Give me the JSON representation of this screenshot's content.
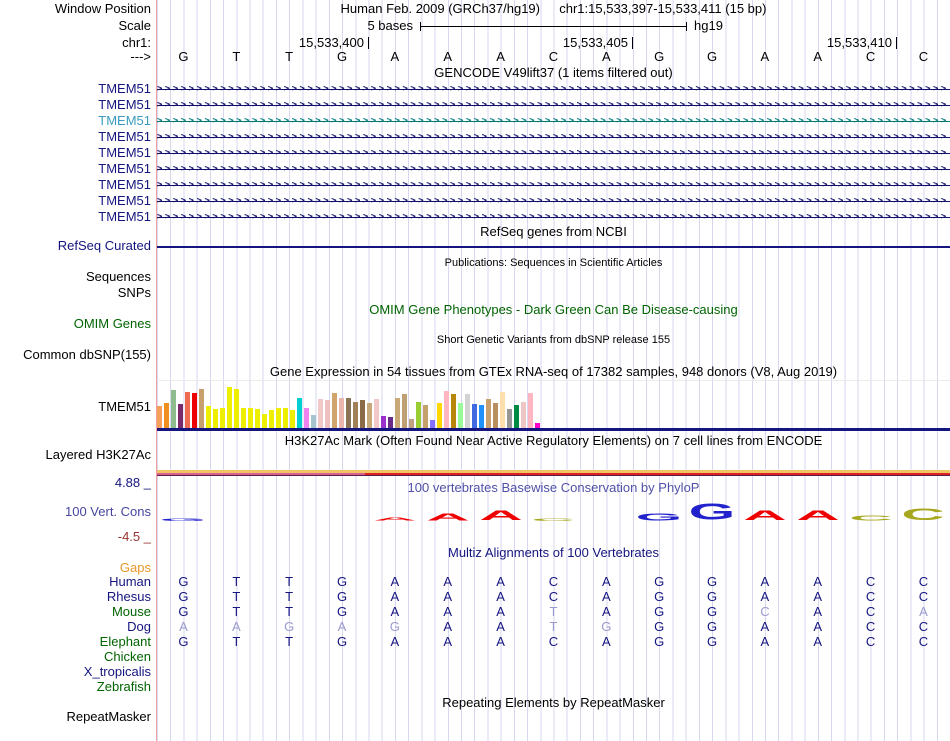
{
  "header": {
    "window_position_label": "Window Position",
    "title_assembly": "Human Feb. 2009 (GRCh37/hg19)",
    "title_range": "chr1:15,533,397-15,533,411 (15 bp)",
    "scale_label": "Scale",
    "scale_bases": "5 bases",
    "scale_assembly": "hg19",
    "chrom_label": "chr1:",
    "strand_arrow": "--->",
    "coordinates": [
      "15,533,400",
      "15,533,405",
      "15,533,410"
    ]
  },
  "sequence": {
    "bases": [
      "G",
      "T",
      "T",
      "G",
      "A",
      "A",
      "A",
      "C",
      "A",
      "G",
      "G",
      "A",
      "A",
      "C",
      "C"
    ]
  },
  "tracks": {
    "gencode": {
      "title": "GENCODE V49lift37 (1 items filtered out)",
      "genes": [
        {
          "label": "TMEM51",
          "label_color": "#151580",
          "arrow_color": "#10106a"
        },
        {
          "label": "TMEM51",
          "label_color": "#151580",
          "arrow_color": "#10106a"
        },
        {
          "label": "TMEM51",
          "label_color": "#3a9bbf",
          "arrow_color": "#007878"
        },
        {
          "label": "TMEM51",
          "label_color": "#151580",
          "arrow_color": "#10106a"
        },
        {
          "label": "TMEM51",
          "label_color": "#151580",
          "arrow_color": "#10106a"
        },
        {
          "label": "TMEM51",
          "label_color": "#151580",
          "arrow_color": "#10106a"
        },
        {
          "label": "TMEM51",
          "label_color": "#151580",
          "arrow_color": "#10106a"
        },
        {
          "label": "TMEM51",
          "label_color": "#151580",
          "arrow_color": "#10106a"
        },
        {
          "label": "TMEM51",
          "label_color": "#151580",
          "arrow_color": "#10106a"
        }
      ]
    },
    "refseq": {
      "title": "RefSeq genes from NCBI",
      "label": "RefSeq Curated"
    },
    "publications": {
      "title": "Publications: Sequences in Scientific Articles",
      "label_sequences": "Sequences",
      "label_snps": "SNPs"
    },
    "omim": {
      "title": "OMIM Gene Phenotypes - Dark Green Can Be Disease-causing",
      "label": "OMIM Genes"
    },
    "dbsnp": {
      "title": "Short Genetic Variants from dbSNP release 155",
      "label": "Common dbSNP(155)"
    },
    "gtex": {
      "title": "Gene Expression in 54 tissues from GTEx RNA-seq of 17382 samples, 948 donors (V8, Aug 2019)",
      "label": "TMEM51",
      "bars": [
        {
          "color": "#f4a05a",
          "h": 0.45
        },
        {
          "color": "#ef8f1f",
          "h": 0.52
        },
        {
          "color": "#8fbc8f",
          "h": 0.8
        },
        {
          "color": "#7a2a6a",
          "h": 0.5
        },
        {
          "color": "#ee6a50",
          "h": 0.75
        },
        {
          "color": "#ee0000",
          "h": 0.72
        },
        {
          "color": "#c8a06e",
          "h": 0.82
        },
        {
          "color": "#eeee00",
          "h": 0.45
        },
        {
          "color": "#eeee00",
          "h": 0.4
        },
        {
          "color": "#eeee00",
          "h": 0.42
        },
        {
          "color": "#eeee00",
          "h": 0.85
        },
        {
          "color": "#eeee00",
          "h": 0.82
        },
        {
          "color": "#eeee00",
          "h": 0.42
        },
        {
          "color": "#eeee00",
          "h": 0.42
        },
        {
          "color": "#eeee00",
          "h": 0.4
        },
        {
          "color": "#eeee00",
          "h": 0.3
        },
        {
          "color": "#eeee00",
          "h": 0.38
        },
        {
          "color": "#eeee00",
          "h": 0.42
        },
        {
          "color": "#eeee00",
          "h": 0.42
        },
        {
          "color": "#eeee00",
          "h": 0.38
        },
        {
          "color": "#00ced1",
          "h": 0.62
        },
        {
          "color": "#ee82ee",
          "h": 0.42
        },
        {
          "color": "#a6c4d0",
          "h": 0.28
        },
        {
          "color": "#f0c8c8",
          "h": 0.6
        },
        {
          "color": "#eec0c0",
          "h": 0.58
        },
        {
          "color": "#d2a56e",
          "h": 0.72
        },
        {
          "color": "#eab6ae",
          "h": 0.62
        },
        {
          "color": "#8b7355",
          "h": 0.62
        },
        {
          "color": "#a08058",
          "h": 0.55
        },
        {
          "color": "#8b6b47",
          "h": 0.58
        },
        {
          "color": "#c8a878",
          "h": 0.52
        },
        {
          "color": "#f2c8c8",
          "h": 0.6
        },
        {
          "color": "#9932cc",
          "h": 0.26
        },
        {
          "color": "#6a2a8a",
          "h": 0.22
        },
        {
          "color": "#c9a877",
          "h": 0.62
        },
        {
          "color": "#bfa075",
          "h": 0.7
        },
        {
          "color": "#c0a080",
          "h": 0.18
        },
        {
          "color": "#9acd32",
          "h": 0.55
        },
        {
          "color": "#c4a06a",
          "h": 0.48
        },
        {
          "color": "#8470ff",
          "h": 0.16
        },
        {
          "color": "#ffd700",
          "h": 0.52
        },
        {
          "color": "#ffb6c1",
          "h": 0.78
        },
        {
          "color": "#b8860b",
          "h": 0.7
        },
        {
          "color": "#98fb98",
          "h": 0.52
        },
        {
          "color": "#d3d3d3",
          "h": 0.7
        },
        {
          "color": "#4169e1",
          "h": 0.5
        },
        {
          "color": "#1e90ff",
          "h": 0.48
        },
        {
          "color": "#c8a06e",
          "h": 0.6
        },
        {
          "color": "#b89060",
          "h": 0.52
        },
        {
          "color": "#ffdead",
          "h": 0.75
        },
        {
          "color": "#969696",
          "h": 0.4
        },
        {
          "color": "#008b45",
          "h": 0.48
        },
        {
          "color": "#eec6c6",
          "h": 0.55
        },
        {
          "color": "#ffb6c1",
          "h": 0.72
        },
        {
          "color": "#ff00cc",
          "h": 0.1
        }
      ]
    },
    "h3k27ac": {
      "title": "H3K27Ac Mark (Often Found Near Active Regulatory Elements) on 7 cell lines from ENCODE",
      "label": "Layered H3K27Ac",
      "band_colors": {
        "top": "#f0c464",
        "pink": "#d8608e",
        "red": "#dd2222",
        "bottom": "#5a1a4a"
      }
    },
    "conservation": {
      "title": "100 vertebrates Basewise Conservation by PhyloP",
      "label": "100 Vert. Cons",
      "max_label": "4.88 _",
      "min_label": "-4.5 _",
      "letters": [
        {
          "letter": "G",
          "color": "#2222cc",
          "h": 0.15
        },
        null,
        null,
        null,
        {
          "letter": "A",
          "color": "#ee0000",
          "h": 0.18
        },
        {
          "letter": "A",
          "color": "#ee0000",
          "h": 0.42
        },
        {
          "letter": "A",
          "color": "#ee0000",
          "h": 0.6
        },
        {
          "letter": "C",
          "color": "#a8a820",
          "h": 0.15
        },
        null,
        {
          "letter": "G",
          "color": "#2222cc",
          "h": 0.45
        },
        {
          "letter": "G",
          "color": "#2222cc",
          "h": 1.0
        },
        {
          "letter": "A",
          "color": "#ee0000",
          "h": 0.6
        },
        {
          "letter": "A",
          "color": "#ee0000",
          "h": 0.6
        },
        {
          "letter": "C",
          "color": "#a8a820",
          "h": 0.32
        },
        {
          "letter": "C",
          "color": "#a8a820",
          "h": 0.72
        }
      ]
    },
    "multiz": {
      "title": "Multiz Alignments of 100 Vertebrates",
      "gaps_label": "Gaps",
      "species": [
        {
          "name": "Human",
          "color": "#151580",
          "bases": [
            "G",
            "T",
            "T",
            "G",
            "A",
            "A",
            "A",
            "C",
            "A",
            "G",
            "G",
            "A",
            "A",
            "C",
            "C"
          ],
          "faded": []
        },
        {
          "name": "Rhesus",
          "color": "#151580",
          "bases": [
            "G",
            "T",
            "T",
            "G",
            "A",
            "A",
            "A",
            "C",
            "A",
            "G",
            "G",
            "A",
            "A",
            "C",
            "C"
          ],
          "faded": []
        },
        {
          "name": "Mouse",
          "color": "#006400",
          "bases": [
            "G",
            "T",
            "T",
            "G",
            "A",
            "A",
            "A",
            "T",
            "A",
            "G",
            "G",
            "C",
            "A",
            "C",
            "A"
          ],
          "faded": [
            7,
            11,
            14
          ]
        },
        {
          "name": "Dog",
          "color": "#151580",
          "bases": [
            "A",
            "A",
            "G",
            "A",
            "G",
            "A",
            "A",
            "T",
            "G",
            "G",
            "G",
            "A",
            "A",
            "C",
            "C"
          ],
          "faded": [
            0,
            1,
            2,
            3,
            4,
            7,
            8
          ]
        },
        {
          "name": "Elephant",
          "color": "#006400",
          "bases": [
            "G",
            "T",
            "T",
            "G",
            "A",
            "A",
            "A",
            "C",
            "A",
            "G",
            "G",
            "A",
            "A",
            "C",
            "C"
          ],
          "faded": []
        },
        {
          "name": "Chicken",
          "color": "#006400",
          "bases": [],
          "faded": []
        },
        {
          "name": "X_tropicalis",
          "color": "#151580",
          "bases": [],
          "faded": []
        },
        {
          "name": "Zebrafish",
          "color": "#006400",
          "bases": [],
          "faded": []
        }
      ]
    },
    "repeatmasker": {
      "title": "Repeating Elements by RepeatMasker",
      "label": "RepeatMasker"
    }
  }
}
